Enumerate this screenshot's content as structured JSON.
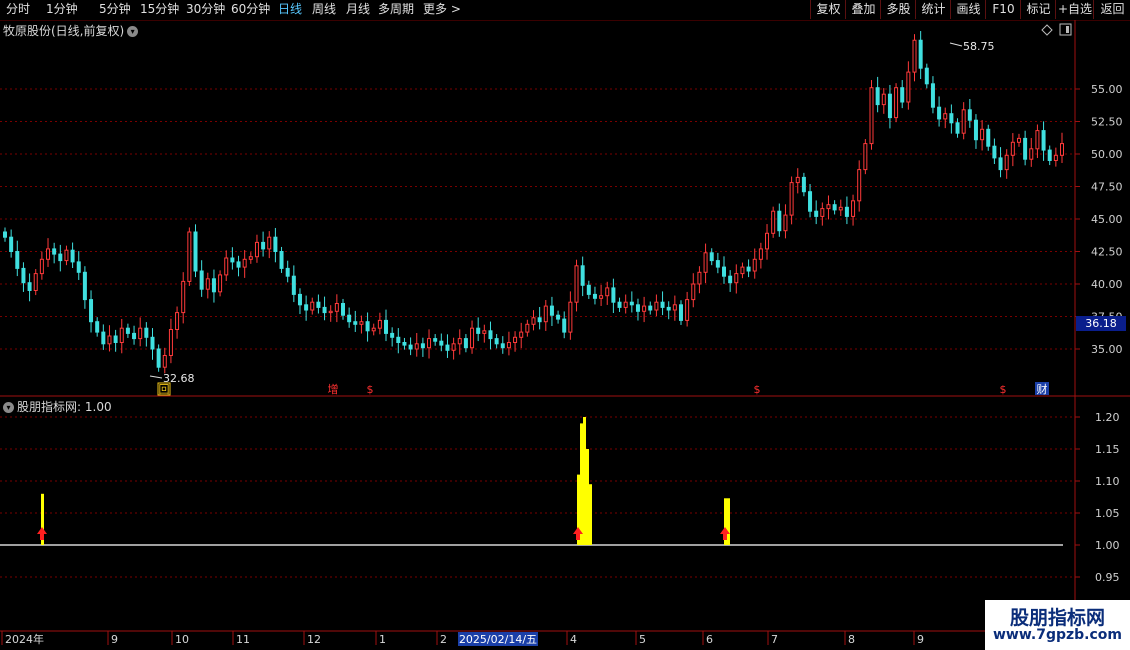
{
  "toolbar": {
    "periods": [
      "分时",
      "1分钟",
      "5分钟",
      "15分钟",
      "30分钟",
      "60分钟",
      "日线",
      "周线",
      "月线",
      "多周期",
      "更多 >"
    ],
    "active_period": "日线",
    "right_buttons": [
      "复权",
      "叠加",
      "多股",
      "统计",
      "画线",
      "F10",
      "标记",
      "+自选",
      "返回"
    ]
  },
  "main_chart": {
    "title": "牧原股份(日线,前复权)",
    "y_ticks": [
      "55.00",
      "52.50",
      "50.00",
      "47.50",
      "45.00",
      "42.50",
      "40.00",
      "37.50",
      "35.00"
    ],
    "current_price": "36.18",
    "high_label": "58.75",
    "low_label": "32.68",
    "markers": [
      {
        "text": "回",
        "color": "#f0c419"
      },
      {
        "text": "增",
        "color": "#ff3030"
      },
      {
        "text": "$",
        "color": "#ff3030"
      },
      {
        "text": "$",
        "color": "#ff3030"
      },
      {
        "text": "$",
        "color": "#ff3030"
      },
      {
        "text": "财",
        "color": "#ffffff"
      }
    ]
  },
  "indicator": {
    "title": "股朋指标网",
    "value_label": ": 1.00",
    "y_ticks": [
      "1.20",
      "1.15",
      "1.10",
      "1.05",
      "1.00",
      "0.95"
    ]
  },
  "xaxis": {
    "labels": [
      "2024年",
      "9",
      "10",
      "11",
      "12",
      "1",
      "2",
      "3",
      "4",
      "5",
      "6",
      "7",
      "8",
      "9"
    ],
    "cursor_date": "2025/02/14/五"
  },
  "watermark": {
    "line1": "股朋指标网",
    "line2": "www.7gpzb.com"
  },
  "colors": {
    "up": "#ff3a3a",
    "down": "#40e0e0",
    "signal": "#ffff00",
    "grid": "#7a0000",
    "axis": "#a01010"
  },
  "chart_data": {
    "type": "candlestick",
    "price_ylim": [
      32,
      60
    ],
    "closes": [
      43.6,
      42.5,
      41.2,
      40.1,
      39.5,
      40.8,
      41.9,
      42.7,
      42.3,
      41.8,
      42.6,
      41.7,
      40.9,
      38.8,
      37.1,
      36.3,
      35.4,
      36.0,
      35.5,
      36.6,
      36.2,
      35.8,
      36.6,
      35.9,
      35.0,
      33.6,
      34.5,
      36.5,
      37.8,
      40.2,
      44.0,
      41.0,
      39.6,
      40.4,
      39.4,
      40.7,
      42.0,
      41.7,
      41.3,
      41.9,
      42.1,
      43.2,
      42.7,
      43.6,
      42.5,
      41.2,
      40.6,
      39.2,
      38.4,
      38.0,
      38.6,
      38.2,
      37.8,
      37.9,
      38.5,
      37.6,
      37.1,
      36.9,
      37.1,
      36.4,
      36.6,
      37.2,
      36.2,
      35.9,
      35.5,
      35.3,
      35.0,
      35.4,
      35.1,
      35.8,
      35.6,
      35.3,
      34.9,
      35.4,
      35.8,
      35.1,
      36.6,
      36.2,
      36.4,
      35.8,
      35.4,
      35.1,
      35.5,
      35.9,
      36.3,
      36.9,
      37.4,
      37.1,
      38.3,
      37.6,
      37.3,
      36.3,
      38.6,
      41.4,
      39.9,
      39.2,
      38.9,
      39.1,
      39.7,
      38.6,
      38.2,
      38.6,
      38.4,
      37.9,
      38.3,
      38.0,
      38.6,
      38.2,
      38.0,
      38.4,
      37.2,
      38.8,
      40.0,
      40.9,
      42.4,
      41.8,
      41.3,
      40.6,
      40.1,
      40.8,
      41.3,
      41.0,
      41.9,
      42.7,
      43.9,
      45.6,
      44.1,
      45.3,
      47.8,
      48.2,
      47.1,
      45.6,
      45.2,
      45.8,
      46.1,
      45.7,
      45.9,
      45.2,
      46.4,
      48.8,
      50.8,
      55.1,
      53.8,
      54.6,
      52.8,
      55.1,
      54.0,
      56.3,
      58.75,
      56.6,
      55.4,
      53.6,
      52.7,
      53.1,
      52.4,
      51.6,
      53.4,
      52.6,
      51.1,
      51.9,
      50.6,
      49.7,
      48.8,
      49.9,
      50.9,
      51.2,
      49.6,
      50.4,
      51.8,
      50.3,
      49.5,
      49.9,
      50.8
    ],
    "x_labels": [
      "2024年",
      "9",
      "10",
      "11",
      "12",
      "1",
      "2",
      "3",
      "4",
      "5",
      "6",
      "7",
      "8",
      "9"
    ],
    "indicator_bars": [
      {
        "label": "signal-1",
        "values": [
          1.08
        ]
      },
      {
        "label": "signal-2",
        "values": [
          1.11,
          1.19,
          1.2,
          1.15,
          1.095
        ]
      },
      {
        "label": "signal-3",
        "values": [
          1.073,
          1.073
        ]
      }
    ],
    "indicator_ylim": [
      0.93,
      1.22
    ],
    "indicator_baseline": 1.0
  }
}
